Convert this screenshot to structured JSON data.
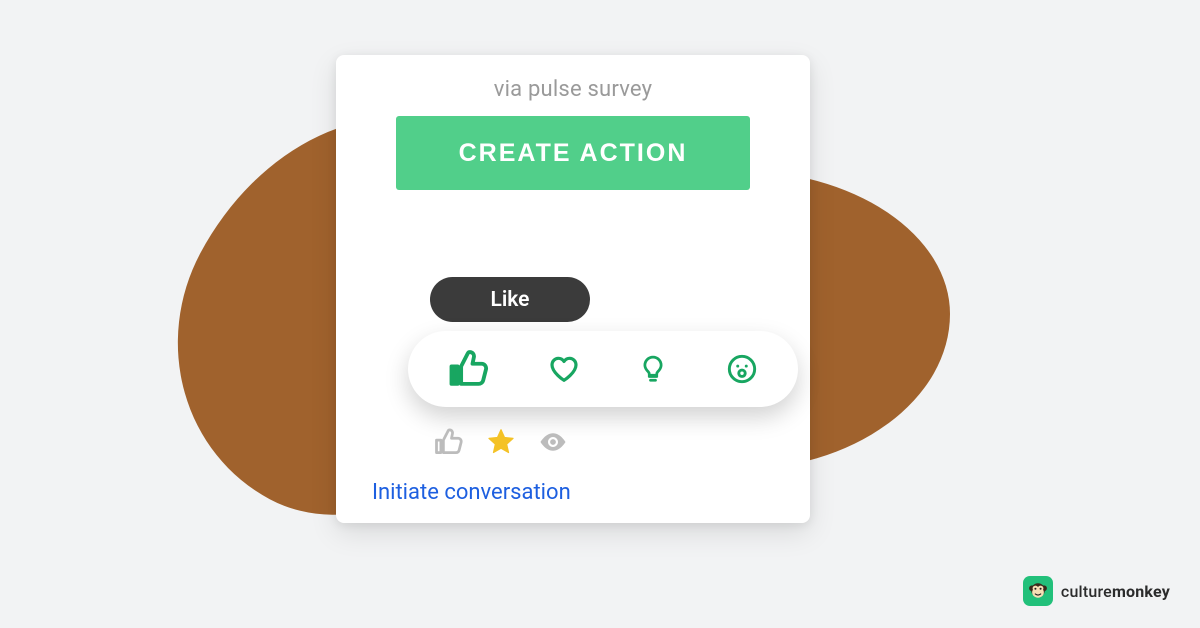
{
  "card": {
    "subtitle": "via pulse survey",
    "create_button_label": "CREATE ACTION",
    "tooltip_label": "Like",
    "initiate_link_label": "Initiate conversation"
  },
  "brand": {
    "name_prefix": "culture",
    "name_bold": "monkey"
  },
  "colors": {
    "accent_green": "#51cf8a",
    "reaction_green": "#18a661",
    "star_yellow": "#f4c226",
    "inactive_grey": "#bcbcbc",
    "link_blue": "#1d5fe0",
    "blob_brown": "#a0622d"
  }
}
